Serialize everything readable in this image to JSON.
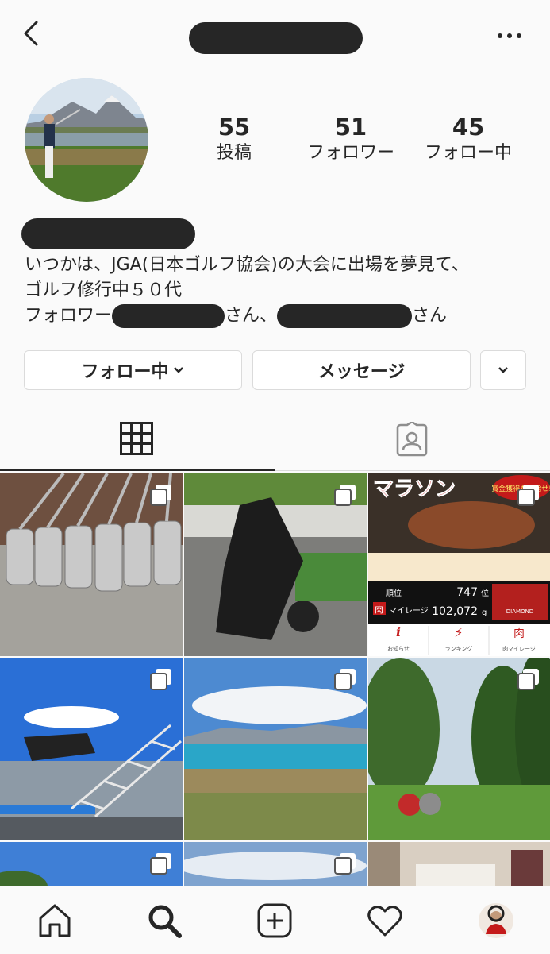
{
  "profile": {
    "stats": [
      {
        "value": "55",
        "label": "投稿"
      },
      {
        "value": "51",
        "label": "フォロワー"
      },
      {
        "value": "45",
        "label": "フォロー中"
      }
    ],
    "bio_line1": "いつかは、JGA(日本ゴルフ協会)の大会に出場を夢見て、",
    "bio_line2": "ゴルフ修行中５０代",
    "followed_by_prefix": "フォロワー",
    "followed_by_mid": "さん、",
    "followed_by_suffix": "さん"
  },
  "actions": {
    "follow_label": "フォロー中",
    "message_label": "メッセージ"
  },
  "tabs": [
    {
      "icon": "grid-icon",
      "active": true
    },
    {
      "icon": "tagged-person-icon",
      "active": false
    }
  ],
  "posts": {
    "tile3": {
      "banner": "マラソン",
      "badge": "賞金獲得を目指せ!",
      "rank_label": "順位",
      "rank_value": "747",
      "rank_unit": "位",
      "mileage_label": "マイレージ",
      "mileage_icon": "肉",
      "mileage_value": "102,072",
      "mileage_unit": "g",
      "nav1": "お知らせ",
      "nav2": "ランキング",
      "nav3": "肉マイレージ",
      "diamond": "DIAMOND"
    }
  },
  "bottom_nav": [
    "home-icon",
    "search-icon",
    "new-post-icon",
    "activity-heart-icon",
    "profile-avatar-icon"
  ],
  "colors": {
    "text": "#262626",
    "border": "#dbdbdb",
    "background": "#fafafa"
  }
}
